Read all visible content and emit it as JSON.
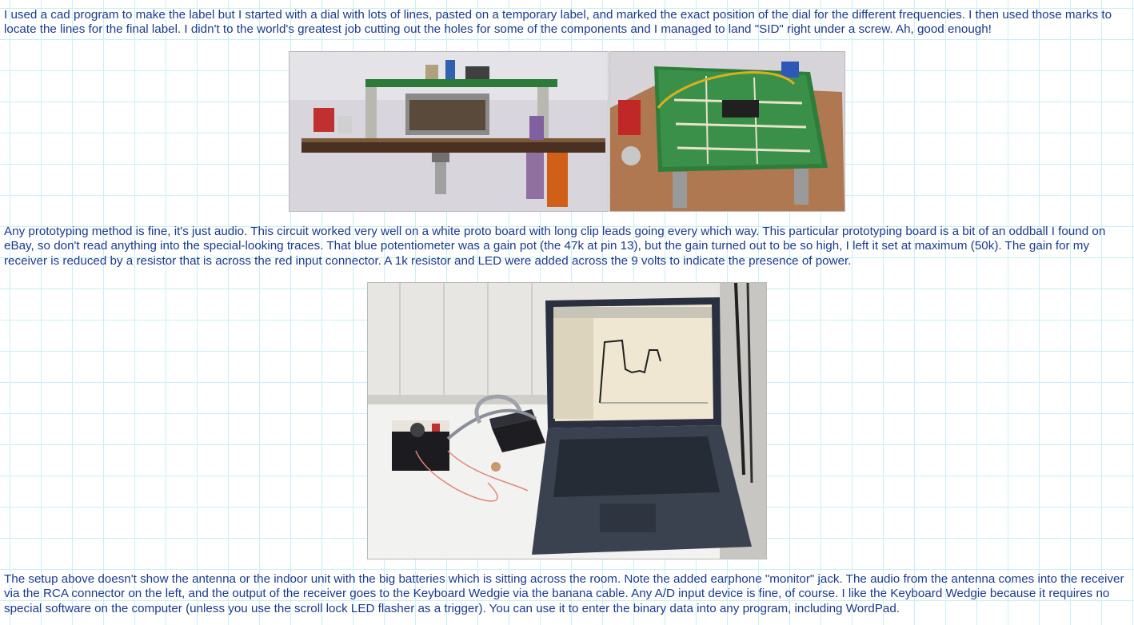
{
  "paragraphs": {
    "intro": "I used a cad program to make the label but I started with a dial with lots of lines, pasted on a temporary label, and marked the exact position of the dial for the different frequencies. I then used those marks to locate the lines for the final label. I didn't to the world's greatest job cutting out the holes for some of the components and I managed to land \"SID\" right under a screw. Ah, good enough!",
    "prototyping": "Any prototyping method is fine, it's just audio. This circuit worked very well on a white proto board with long clip leads going every which way. This particular prototyping board is a bit of an oddball I found on eBay, so don't read anything into the special-looking traces. That blue potentiometer was a gain pot (the 47k at pin 13), but the gain turned out to be so high, I left it set at maximum (50k). The gain for my receiver is reduced by a resistor that is across the red input connector. A 1k resistor and LED were added across the 9 volts to indicate the presence of power.",
    "setup": "The setup above doesn't show the antenna or the indoor unit with the big batteries which is sitting across the room. Note the added earphone \"monitor\" jack. The audio from the antenna comes into the receiver via the RCA connector on the left, and the output of the receiver goes to the Keyboard Wedgie via the banana cable. Any A/D input device is fine, of course. I like the Keyboard Wedgie because it requires no special software on the computer (unless you use the scroll lock LED flasher as a trigger). You can use it to enter the binary data into any program, including WordPad."
  },
  "colors": {
    "text": "#1a3a8c",
    "grid": "#c9eff5",
    "background": "#ffffff"
  }
}
